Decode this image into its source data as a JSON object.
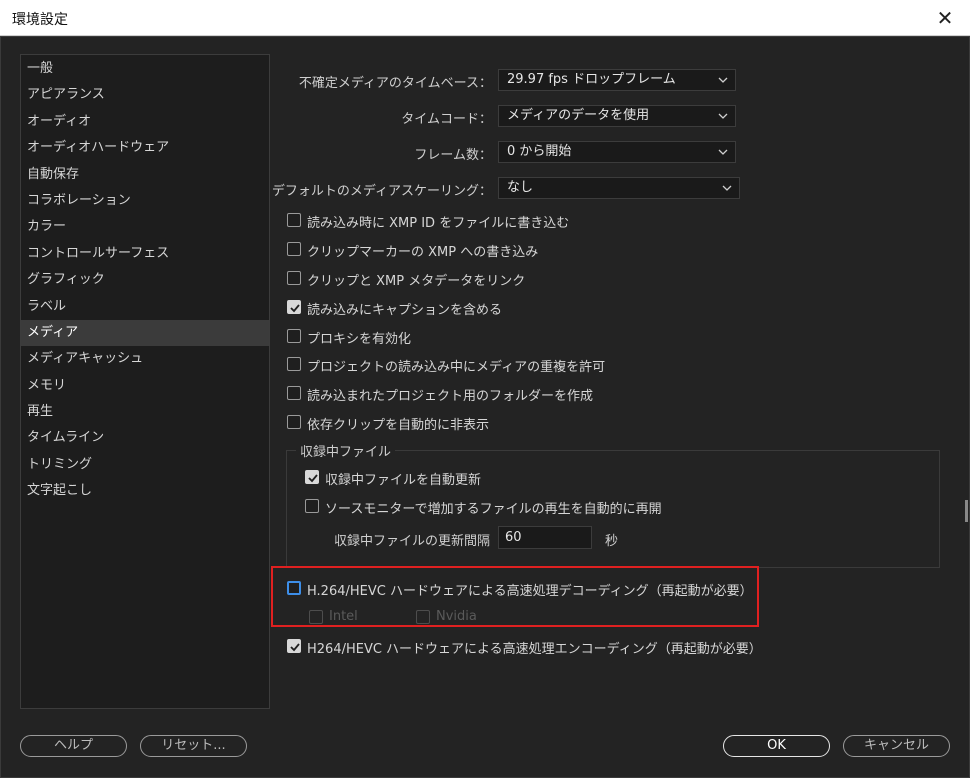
{
  "window": {
    "title": "環境設定",
    "close_glyph": "✕"
  },
  "sidebar": {
    "items": [
      {
        "label": "一般"
      },
      {
        "label": "アピアランス"
      },
      {
        "label": "オーディオ"
      },
      {
        "label": "オーディオハードウェア"
      },
      {
        "label": "自動保存"
      },
      {
        "label": "コラボレーション"
      },
      {
        "label": "カラー"
      },
      {
        "label": "コントロールサーフェス"
      },
      {
        "label": "グラフィック"
      },
      {
        "label": "ラベル"
      },
      {
        "label": "メディア",
        "selected": true
      },
      {
        "label": "メディアキャッシュ"
      },
      {
        "label": "メモリ"
      },
      {
        "label": "再生"
      },
      {
        "label": "タイムライン"
      },
      {
        "label": "トリミング"
      },
      {
        "label": "文字起こし"
      }
    ]
  },
  "media": {
    "timebase": {
      "label": "不確定メディアのタイムベース：",
      "value": "29.97  fps ドロップフレーム"
    },
    "timecode": {
      "label": "タイムコード：",
      "value": "メディアのデータを使用"
    },
    "frame_count": {
      "label": "フレーム数：",
      "value": "0 から開始"
    },
    "default_scaling": {
      "label": "デフォルトのメディアスケーリング：",
      "value": "なし"
    },
    "checkboxes": [
      {
        "label": "読み込み時に XMP ID をファイルに書き込む",
        "checked": false
      },
      {
        "label": "クリップマーカーの XMP への書き込み",
        "checked": false
      },
      {
        "label": "クリップと XMP メタデータをリンク",
        "checked": false
      },
      {
        "label": "読み込みにキャプションを含める",
        "checked": true
      },
      {
        "label": "プロキシを有効化",
        "checked": false
      },
      {
        "label": "プロジェクトの読み込み中にメディアの重複を許可",
        "checked": false
      },
      {
        "label": "読み込まれたプロジェクト用のフォルダーを作成",
        "checked": false
      },
      {
        "label": "依存クリップを自動的に非表示",
        "checked": false
      }
    ],
    "growing_files": {
      "title": "収録中ファイル",
      "auto_refresh": {
        "label": "収録中ファイルを自動更新",
        "checked": true
      },
      "auto_play": {
        "label": "ソースモニターで増加するファイルの再生を自動的に再開",
        "checked": false
      },
      "interval_label": "収録中ファイルの更新間隔",
      "interval_value": "60",
      "interval_unit": "秒"
    },
    "hw_decode": {
      "label": "H.264/HEVC ハードウェアによる高速処理デコーディング（再起動が必要）",
      "checked": false
    },
    "intel": {
      "label": "Intel",
      "checked": false
    },
    "nvidia": {
      "label": "Nvidia",
      "checked": false
    },
    "hw_encode": {
      "label": "H264/HEVC ハードウェアによる高速処理エンコーディング（再起動が必要）",
      "checked": true
    }
  },
  "buttons": {
    "help": "ヘルプ",
    "reset": "リセット...",
    "ok": "OK",
    "cancel": "キャンセル"
  },
  "colors": {
    "highlight": "#e02020",
    "focus": "#3d8ee8",
    "background": "#232323"
  }
}
